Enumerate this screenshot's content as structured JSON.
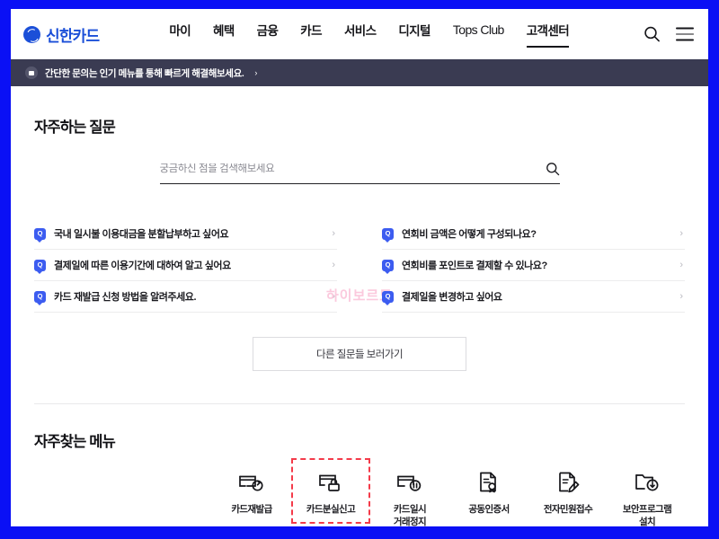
{
  "frame": {
    "border_color": "#0a10f5"
  },
  "header": {
    "logo_text": "신한카드",
    "logo_icon": "shinhan-circle-logo",
    "nav": [
      {
        "label": "마이",
        "active": false,
        "latin": false
      },
      {
        "label": "혜택",
        "active": false,
        "latin": false
      },
      {
        "label": "금융",
        "active": false,
        "latin": false
      },
      {
        "label": "카드",
        "active": false,
        "latin": false
      },
      {
        "label": "서비스",
        "active": false,
        "latin": false
      },
      {
        "label": "디지털",
        "active": false,
        "latin": false
      },
      {
        "label": "Tops Club",
        "active": false,
        "latin": true
      },
      {
        "label": "고객센터",
        "active": true,
        "latin": false
      }
    ],
    "search_icon": "search-icon",
    "menu_icon": "hamburger-menu-icon"
  },
  "banner": {
    "icon": "speaker-icon",
    "text": "간단한 문의는 인기 메뉴를 통해 빠르게 해결해보세요.",
    "arrow": "›"
  },
  "faq": {
    "title": "자주하는 질문",
    "search": {
      "placeholder": "궁금하신 점을 검색해보세요",
      "value": "",
      "icon": "search-icon"
    },
    "watermark": "하이보르도",
    "badge_letter": "Q",
    "chevron": "›",
    "items_left": [
      "국내 일시불 이용대금을 분할납부하고 싶어요",
      "결제일에 따른 이용기간에 대하여 알고 싶어요",
      "카드 재발급 신청 방법을 알려주세요."
    ],
    "items_right": [
      "연회비 금액은 어떻게 구성되나요?",
      "연회비를 포인트로 결제할 수 있나요?",
      "결제일을 변경하고 싶어요"
    ],
    "more_button": "다른 질문들 보러가기"
  },
  "quick_menu": {
    "title": "자주찾는 메뉴",
    "highlight_color": "#f43b4a",
    "items": [
      {
        "label": "카드재발급",
        "icon": "card-reissue-icon",
        "highlighted": false
      },
      {
        "label": "카드분실신고",
        "icon": "card-loss-report-icon",
        "highlighted": true
      },
      {
        "label": "카드일시\n거래정지",
        "icon": "card-suspend-icon",
        "highlighted": false
      },
      {
        "label": "공동인증서",
        "icon": "certificate-icon",
        "highlighted": false
      },
      {
        "label": "전자민원접수",
        "icon": "e-complaint-icon",
        "highlighted": false
      },
      {
        "label": "보안프로그램\n설치",
        "icon": "security-program-install-icon",
        "highlighted": false
      }
    ]
  }
}
